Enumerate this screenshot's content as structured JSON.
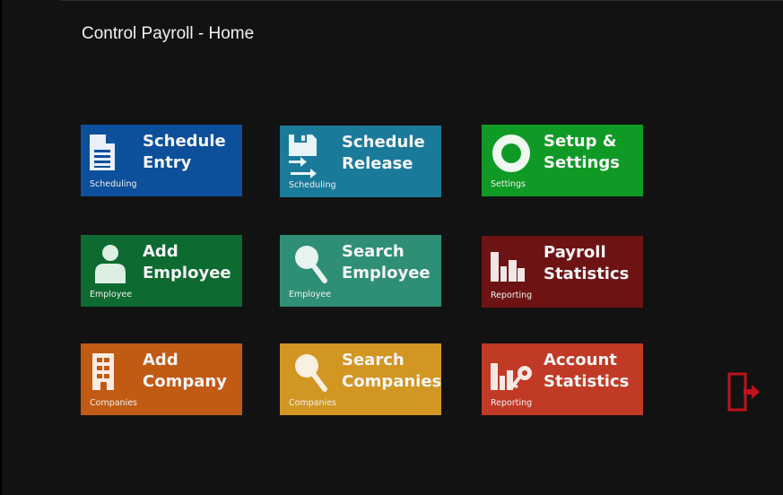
{
  "app": {
    "title": "Control Payroll - Home"
  },
  "tiles": [
    {
      "label": "Schedule\nEntry",
      "category": "Scheduling",
      "icon": "document-icon",
      "color": "#0c4f9a"
    },
    {
      "label": "Schedule\nRelease",
      "category": "Scheduling",
      "icon": "save-release-icon",
      "color": "#1a7a9a"
    },
    {
      "label": "Setup &\nSettings",
      "category": "Settings",
      "icon": "settings-ring-icon",
      "color": "#0f9a26"
    },
    {
      "label": "Add\nEmployee",
      "category": "Employee",
      "icon": "person-icon",
      "color": "#0d6a31"
    },
    {
      "label": "Search\nEmployee",
      "category": "Employee",
      "icon": "magnifier-icon",
      "color": "#2f8f76"
    },
    {
      "label": "Payroll\nStatistics",
      "category": "Reporting",
      "icon": "bar-chart-icon",
      "color": "#6e1314"
    },
    {
      "label": "Add\nCompany",
      "category": "Companies",
      "icon": "building-icon",
      "color": "#c15a13"
    },
    {
      "label": "Search\nCompanies",
      "category": "Companies",
      "icon": "magnifier-icon",
      "color": "#d29623"
    },
    {
      "label": "Account\nStatistics",
      "category": "Reporting",
      "icon": "chart-key-icon",
      "color": "#c03a26"
    }
  ],
  "exit": {
    "icon": "exit-door-icon",
    "color": "#c0121c"
  }
}
